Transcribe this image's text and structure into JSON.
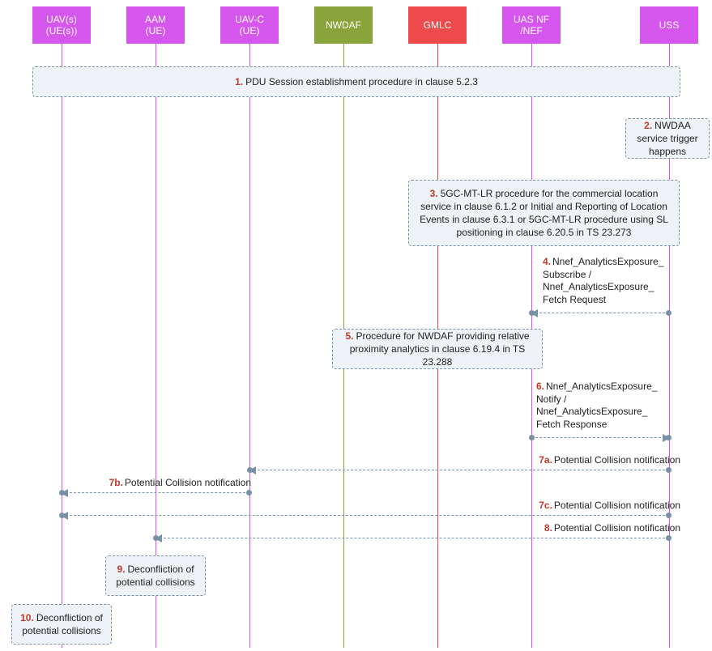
{
  "participants": {
    "uav": "UAV(s)\n(UE(s))",
    "aam": "AAM\n(UE)",
    "uavc": "UAV-C\n(UE)",
    "nwdaf": "NWDAF",
    "gmlc": "GMLC",
    "uasnf": "UAS NF\n/NEF",
    "uss": "USS"
  },
  "boxes": {
    "b1": {
      "num": "1.",
      "text": "PDU Session establishment procedure in clause 5.2.3"
    },
    "b2": {
      "num": "2.",
      "text": "NWDAA service trigger happens"
    },
    "b3": {
      "num": "3.",
      "text": "5GC-MT-LR procedure for the commercial location service in clause 6.1.2 or Initial and Reporting of Location Events in clause 6.3.1 or 5GC-MT-LR procedure using SL positioning in clause 6.20.5 in TS 23.273"
    },
    "b5": {
      "num": "5.",
      "text": "Procedure for NWDAF providing relative proximity analytics in clause 6.19.4 in TS 23.288"
    },
    "b9": {
      "num": "9.",
      "text": "Deconfliction of potential collisions"
    },
    "b10": {
      "num": "10.",
      "text": "Deconfliction of potential collisions"
    }
  },
  "messages": {
    "m4": {
      "num": "4.",
      "text": "Nnef_AnalyticsExposure_\nSubscribe /\nNnef_AnalyticsExposure_\nFetch Request"
    },
    "m6": {
      "num": "6.",
      "text": "Nnef_AnalyticsExposure_\nNotify /\nNnef_AnalyticsExposure_\nFetch Response"
    },
    "m7a": {
      "num": "7a.",
      "text": "Potential Collision notification"
    },
    "m7b": {
      "num": "7b.",
      "text": "Potential Collision notification"
    },
    "m7c": {
      "num": "7c.",
      "text": "Potential Collision notification"
    },
    "m8": {
      "num": "8.",
      "text": "Potential Collision notification"
    }
  }
}
